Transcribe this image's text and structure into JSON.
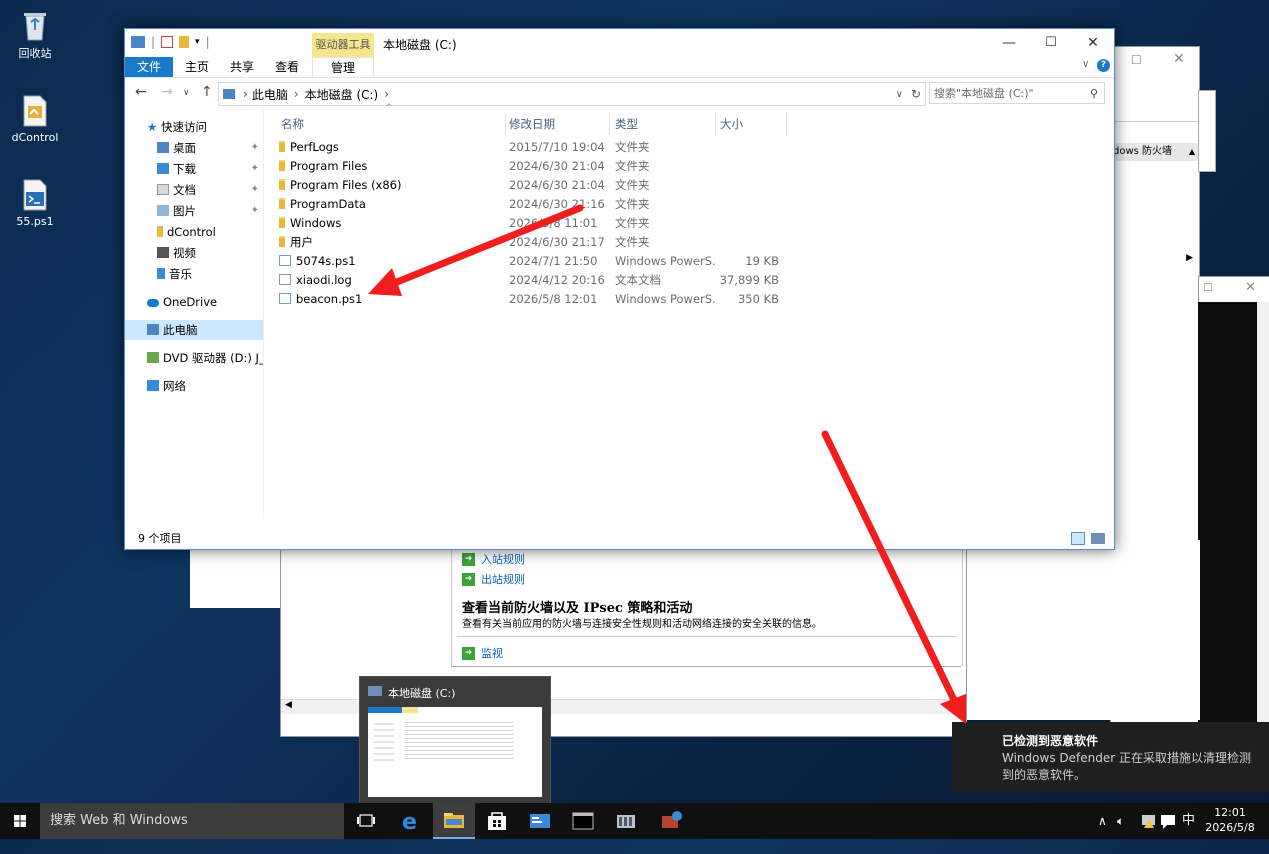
{
  "desktop": {
    "icons": [
      {
        "label": "回收站",
        "icon": "recycle-bin-icon"
      },
      {
        "label": "dControl",
        "icon": "app-file-icon"
      },
      {
        "label": "55.ps1",
        "icon": "powershell-script-icon"
      }
    ]
  },
  "explorer": {
    "title": "本地磁盘 (C:)",
    "context_tab": "驱动器工具",
    "ribbon_tabs": [
      "文件",
      "主页",
      "共享",
      "查看",
      "管理"
    ],
    "address": {
      "parts": [
        "此电脑",
        "本地磁盘 (C:)"
      ],
      "sep": "›"
    },
    "search_placeholder": "搜索\"本地磁盘 (C:)\"",
    "nav": [
      {
        "label": "快速访问",
        "icon": "star-icon"
      },
      {
        "label": "桌面",
        "icon": "desktop-folder-icon",
        "pinned": true
      },
      {
        "label": "下载",
        "icon": "download-folder-icon",
        "pinned": true
      },
      {
        "label": "文档",
        "icon": "documents-folder-icon",
        "pinned": true
      },
      {
        "label": "图片",
        "icon": "pictures-folder-icon",
        "pinned": true
      },
      {
        "label": "dControl",
        "icon": "folder-icon"
      },
      {
        "label": "视频",
        "icon": "videos-folder-icon"
      },
      {
        "label": "音乐",
        "icon": "music-folder-icon"
      },
      {
        "label": "OneDrive",
        "icon": "cloud-icon"
      },
      {
        "label": "此电脑",
        "icon": "computer-icon",
        "selected": true
      },
      {
        "label": "DVD 驱动器 (D:) J_C",
        "icon": "dvd-drive-icon"
      },
      {
        "label": "网络",
        "icon": "network-icon"
      }
    ],
    "columns": [
      "名称",
      "修改日期",
      "类型",
      "大小"
    ],
    "files": [
      {
        "name": "PerfLogs",
        "date": "2015/7/10 19:04",
        "type": "文件夹",
        "size": "",
        "kind": "folder"
      },
      {
        "name": "Program Files",
        "date": "2024/6/30 21:04",
        "type": "文件夹",
        "size": "",
        "kind": "folder"
      },
      {
        "name": "Program Files (x86)",
        "date": "2024/6/30 21:04",
        "type": "文件夹",
        "size": "",
        "kind": "folder"
      },
      {
        "name": "ProgramData",
        "date": "2024/6/30 21:16",
        "type": "文件夹",
        "size": "",
        "kind": "folder"
      },
      {
        "name": "Windows",
        "date": "2026/5/8 11:01",
        "type": "文件夹",
        "size": "",
        "kind": "folder"
      },
      {
        "name": "用户",
        "date": "2024/6/30 21:17",
        "type": "文件夹",
        "size": "",
        "kind": "folder"
      },
      {
        "name": "5074s.ps1",
        "date": "2024/7/1 21:50",
        "type": "Windows PowerS...",
        "size": "19 KB",
        "kind": "script"
      },
      {
        "name": "xiaodi.log",
        "date": "2024/4/12 20:16",
        "type": "文本文档",
        "size": "37,899 KB",
        "kind": "text"
      },
      {
        "name": "beacon.ps1",
        "date": "2026/5/8 12:01",
        "type": "Windows PowerS...",
        "size": "350 KB",
        "kind": "script"
      }
    ],
    "status": "9 个项目"
  },
  "firewall_window": {
    "header_snippet": "dows 防火墙",
    "link_inbound": "入站规则",
    "link_outbound": "出站规则",
    "section_title": "查看当前防火墙以及 IPsec 策略和活动",
    "section_desc": "查看有关当前应用的防火墙与连接安全性规则和活动网络连接的安全关联的信息。",
    "link_monitor": "监视"
  },
  "thumbnail": {
    "title": "本地磁盘 (C:)"
  },
  "toast": {
    "title": "已检测到恶意软件",
    "body": "Windows Defender 正在采取措施以清理检测到的恶意软件。"
  },
  "taskbar": {
    "search_placeholder": "搜索 Web 和 Windows",
    "ime": "中",
    "time": "12:01",
    "date": "2026/5/8"
  },
  "colors": {
    "accent": "#1979ca",
    "selection": "#cce8ff",
    "annotation_arrow": "#f21d1d"
  }
}
